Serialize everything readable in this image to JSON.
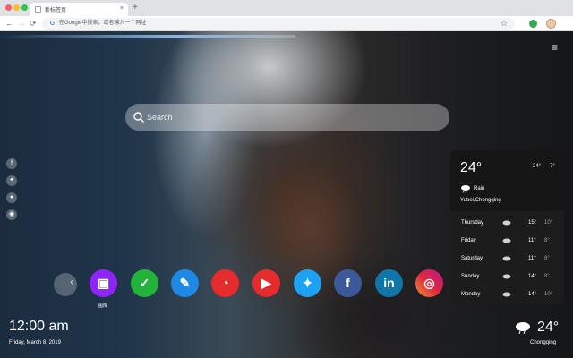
{
  "browser": {
    "tab_title": "新标签页",
    "tab_close": "×",
    "new_tab": "+",
    "back": "←",
    "forward": "→",
    "reload": "⟳",
    "omnibox_text": "在Google中搜索，或者输入一个网址",
    "g_letter": "G",
    "star": "☆",
    "menu": "⋮"
  },
  "page": {
    "menu_icon": "≡",
    "search": {
      "placeholder": "Search"
    },
    "social_icons": [
      "facebook-icon",
      "twitter-icon",
      "google-icon",
      "reddit-icon"
    ],
    "apps": [
      {
        "name": "gallery-app",
        "glyph": "▣",
        "color": "#8e24f5",
        "label": "图库"
      },
      {
        "name": "tasks-app",
        "glyph": "✓",
        "color": "#22b33a",
        "label": ""
      },
      {
        "name": "notes-app",
        "glyph": "✎",
        "color": "#1e88e5",
        "label": ""
      },
      {
        "name": "game-app",
        "glyph": "◔",
        "color": "#e52b2b",
        "label": ""
      },
      {
        "name": "youtube-app",
        "glyph": "▶",
        "color": "#e52b2b",
        "label": ""
      },
      {
        "name": "twitter-app",
        "glyph": "✦",
        "color": "#1da1f2",
        "label": ""
      },
      {
        "name": "facebook-app",
        "glyph": "f",
        "color": "#3b5998",
        "label": ""
      },
      {
        "name": "linkedin-app",
        "glyph": "in",
        "color": "#0e76a8",
        "label": ""
      },
      {
        "name": "instagram-app",
        "glyph": "◎",
        "color": "#d6249f",
        "label": ""
      }
    ],
    "weather": {
      "temp": "24°",
      "hi": "24°",
      "lo": "7°",
      "condition": "Rain",
      "location": "Yubei,Chongqing",
      "forecast": [
        {
          "day": "Thursday",
          "hi": "15°",
          "lo": "10°"
        },
        {
          "day": "Friday",
          "hi": "11°",
          "lo": "8°"
        },
        {
          "day": "Saturday",
          "hi": "11°",
          "lo": "8°"
        },
        {
          "day": "Sunday",
          "hi": "14°",
          "lo": "8°"
        },
        {
          "day": "Monday",
          "hi": "14°",
          "lo": "10°"
        }
      ]
    },
    "clock": {
      "time": "12:00 am",
      "date": "Friday, March 8, 2019"
    },
    "bottom_weather": {
      "temp": "24°",
      "city": "Chongqing"
    }
  }
}
